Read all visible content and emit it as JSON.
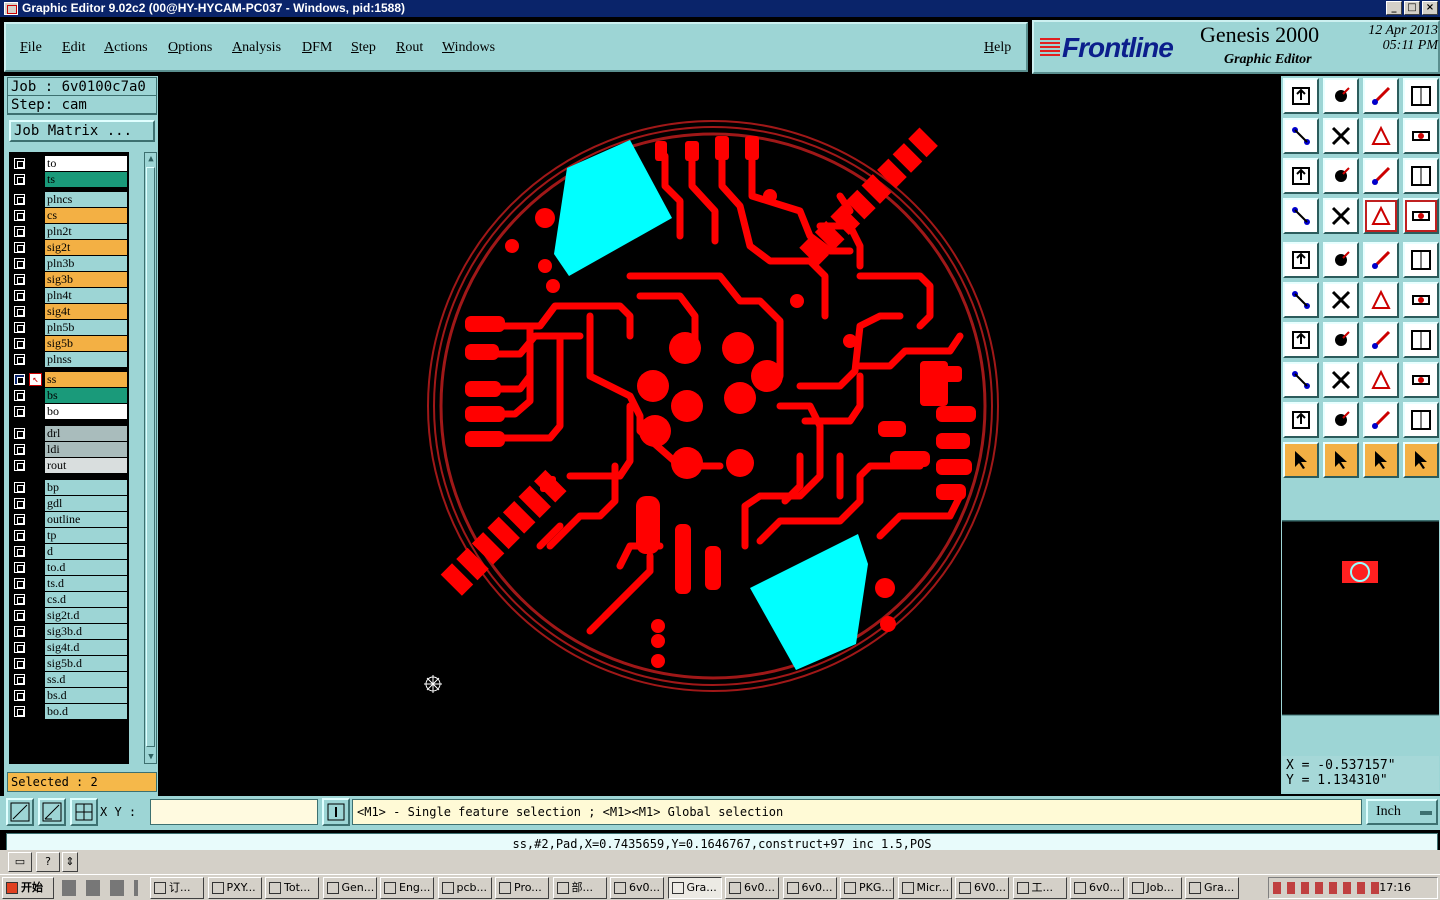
{
  "window": {
    "title": "Graphic Editor 9.02c2 (00@HY-HYCAM-PC037 - Windows, pid:1588)",
    "buttons": [
      "_",
      "□",
      "×"
    ]
  },
  "menu": {
    "items": [
      "File",
      "Edit",
      "Actions",
      "Options",
      "Analysis",
      "DFM",
      "Step",
      "Rout",
      "Windows"
    ],
    "help": "Help"
  },
  "brand": {
    "logo": "Frontline",
    "product": "Genesis 2000",
    "subtitle": "Graphic Editor",
    "date": "12 Apr 2013",
    "time": "05:11 PM"
  },
  "job": {
    "job_line": "Job : 6v0100c7a0",
    "step_line": "Step: cam",
    "matrix_button": "Job Matrix ..."
  },
  "layers": [
    {
      "name": "to",
      "color": "#ffffff"
    },
    {
      "name": "ts",
      "color": "#1a9a7a"
    },
    {
      "name": "plncs",
      "color": "#9dd5d5"
    },
    {
      "name": "cs",
      "color": "#f3b044"
    },
    {
      "name": "pln2t",
      "color": "#9dd5d5"
    },
    {
      "name": "sig2t",
      "color": "#f3b044"
    },
    {
      "name": "pln3b",
      "color": "#9dd5d5"
    },
    {
      "name": "sig3b",
      "color": "#f3b044"
    },
    {
      "name": "pln4t",
      "color": "#9dd5d5"
    },
    {
      "name": "sig4t",
      "color": "#f3b044"
    },
    {
      "name": "pln5b",
      "color": "#9dd5d5"
    },
    {
      "name": "sig5b",
      "color": "#f3b044"
    },
    {
      "name": "plnss",
      "color": "#9dd5d5"
    },
    {
      "name": "ss",
      "color": "#f3b044",
      "active": true
    },
    {
      "name": "bs",
      "color": "#1a9a7a"
    },
    {
      "name": "bo",
      "color": "#ffffff"
    },
    {
      "name": "drl",
      "color": "#a9bcbc"
    },
    {
      "name": "ldi",
      "color": "#a9bcbc"
    },
    {
      "name": "rout",
      "color": "#d9dede"
    },
    {
      "name": "bp",
      "color": "#9dd5d5"
    },
    {
      "name": "gdl",
      "color": "#9dd5d5"
    },
    {
      "name": "outline",
      "color": "#9dd5d5"
    },
    {
      "name": "tp",
      "color": "#9dd5d5"
    },
    {
      "name": "d",
      "color": "#9dd5d5"
    },
    {
      "name": "to.d",
      "color": "#9dd5d5"
    },
    {
      "name": "ts.d",
      "color": "#9dd5d5"
    },
    {
      "name": "cs.d",
      "color": "#9dd5d5"
    },
    {
      "name": "sig2t.d",
      "color": "#9dd5d5"
    },
    {
      "name": "sig3b.d",
      "color": "#9dd5d5"
    },
    {
      "name": "sig4t.d",
      "color": "#9dd5d5"
    },
    {
      "name": "sig5b.d",
      "color": "#9dd5d5"
    },
    {
      "name": "ss.d",
      "color": "#9dd5d5"
    },
    {
      "name": "bs.d",
      "color": "#9dd5d5"
    },
    {
      "name": "bo.d",
      "color": "#9dd5d5"
    }
  ],
  "selected_text": "Selected : 2",
  "coords": {
    "x": "X = -0.537157\"",
    "y": "Y = 1.134310\""
  },
  "command": {
    "xy_label": "X Y :",
    "xy_value": "",
    "prompt": "<M1> - Single feature selection ; <M1><M1> Global selection",
    "unit": "Inch"
  },
  "info_line": "ss,#2,Pad,X=0.7435659,Y=0.1646767,construct+97_inc_1.5,POS",
  "colors": {
    "panel": "#9dd5d5",
    "feature": "#ff0000",
    "selected": "#00ffff",
    "outline": "#b01818"
  },
  "taskbar": {
    "start": "开始",
    "items": [
      "订...",
      "PXY...",
      "Tot...",
      "Gen...",
      "Eng...",
      "pcb...",
      "Pro...",
      "部...",
      "6v0...",
      "Gra...",
      "6v0...",
      "6v0...",
      "PKG...",
      "Micr...",
      "6V0...",
      "工...",
      "6v0...",
      "Job...",
      "Gra..."
    ],
    "active_index": 9,
    "clock": "17:16"
  }
}
